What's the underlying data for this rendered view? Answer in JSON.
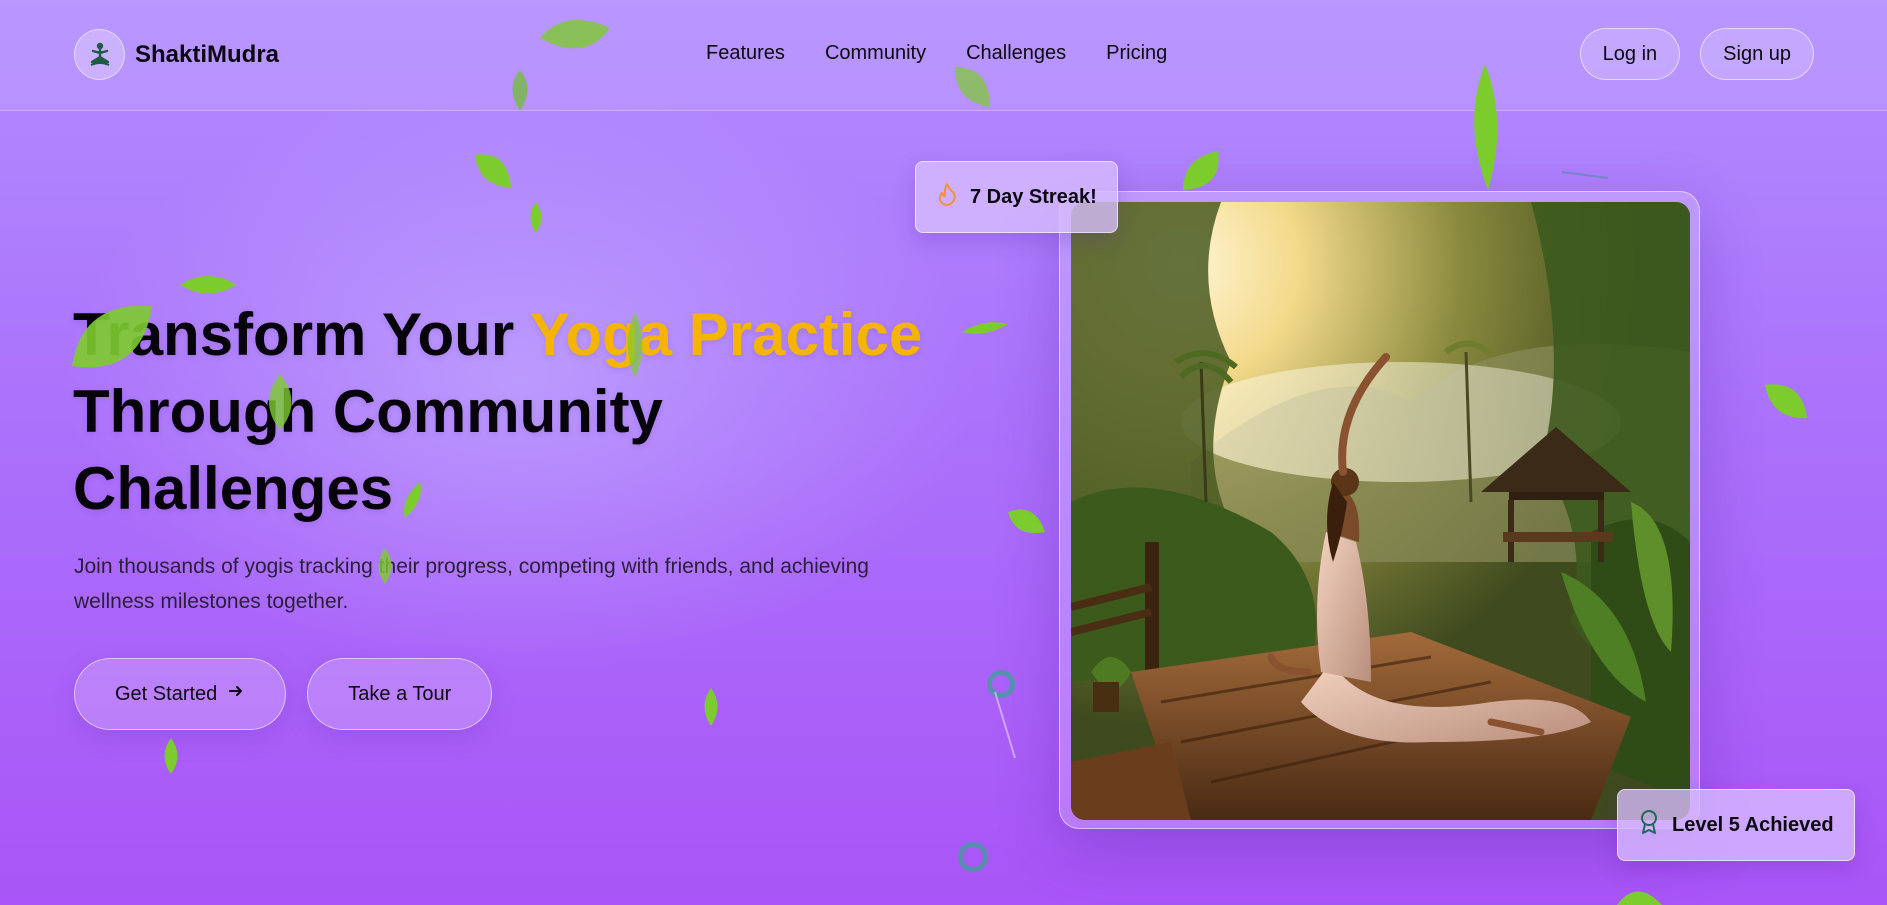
{
  "brand": {
    "name": "ShaktiMudra",
    "logo_icon": "meditation-figure-icon"
  },
  "nav": {
    "items": [
      "Features",
      "Community",
      "Challenges",
      "Pricing"
    ]
  },
  "auth": {
    "login_label": "Log in",
    "signup_label": "Sign up"
  },
  "hero": {
    "title_part1": "Transform Your ",
    "title_accent": "Yoga Practice",
    "title_part2": "Through Community",
    "title_part3": "Challenges",
    "subtitle": "Join thousands of yogis tracking their progress, competing with friends, and achieving wellness milestones together.",
    "primary_cta": "Get Started",
    "secondary_cta": "Take a Tour"
  },
  "badges": {
    "streak": {
      "label": "7 Day Streak!",
      "icon": "flame-icon"
    },
    "level": {
      "label": "Level 5 Achieved",
      "icon": "award-ribbon-icon"
    }
  },
  "colors": {
    "accent": "#f5b400",
    "background_top": "#b18cff",
    "background_bottom": "#a955f7",
    "leaf": "#7dcc2e"
  }
}
